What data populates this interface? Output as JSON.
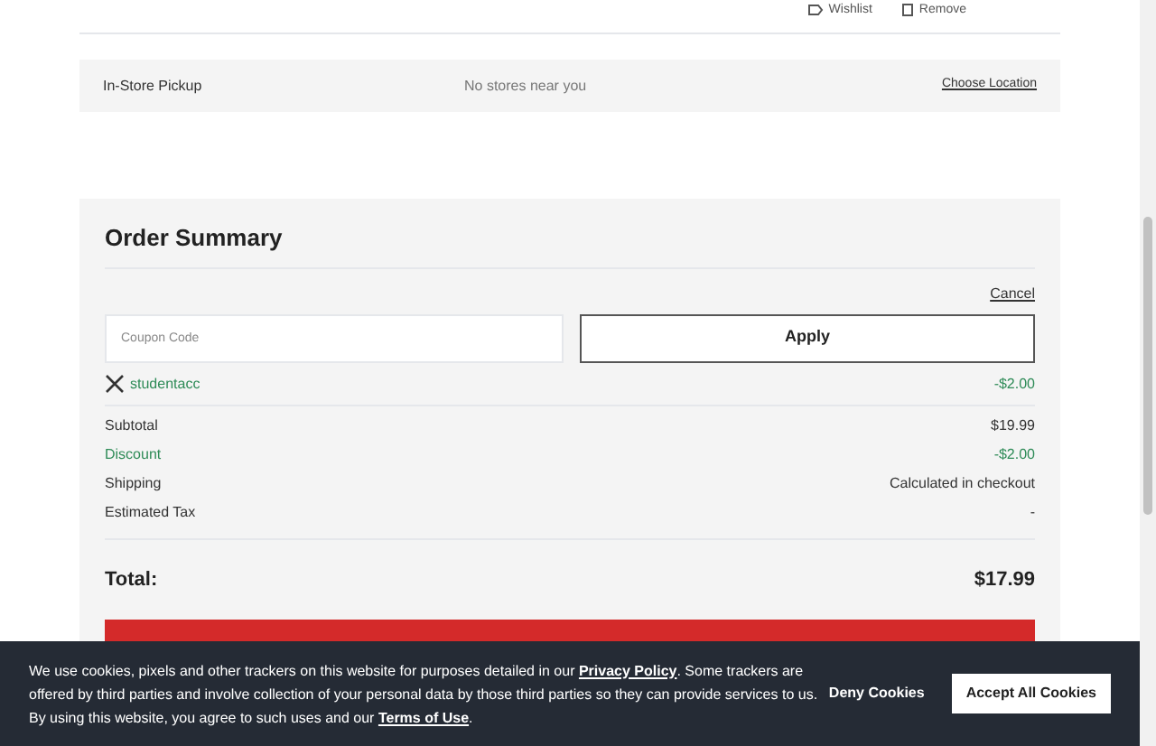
{
  "item_actions": [
    {
      "kind": "wishlist",
      "label": "Wishlist"
    },
    {
      "kind": "remove",
      "label": "Remove"
    }
  ],
  "pickup": {
    "label": "In-Store Pickup",
    "status": "No stores near you",
    "link": "Choose Location"
  },
  "order_summary": {
    "title": "Order Summary",
    "cancel": "Cancel",
    "coupon": {
      "placeholder": "Coupon Code",
      "button": "Apply"
    },
    "applied_coupon": {
      "code": "studentacc",
      "amount": "-$2.00"
    },
    "lines": [
      {
        "label": "Subtotal",
        "value": "$19.99",
        "discount": false
      },
      {
        "label": "Discount",
        "value": "-$2.00",
        "discount": true
      },
      {
        "label": "Shipping",
        "value": "Calculated in checkout",
        "discount": false
      },
      {
        "label": "Estimated Tax",
        "value": "-",
        "discount": false
      }
    ],
    "total": {
      "label": "Total:",
      "value": "$17.99"
    }
  },
  "cookie_banner": {
    "text_before": "We use cookies, pixels and other trackers on this website for purposes detailed in our ",
    "privacy_link": "Privacy Policy",
    "text_middle": ". Some trackers are offered by third parties and involve collection of your personal data by those third parties so they can provide services to us. By using this website, you agree to such uses and our ",
    "terms_link": "Terms of Use",
    "text_after": ".",
    "deny": "Deny Cookies",
    "accept": "Accept All Cookies"
  }
}
